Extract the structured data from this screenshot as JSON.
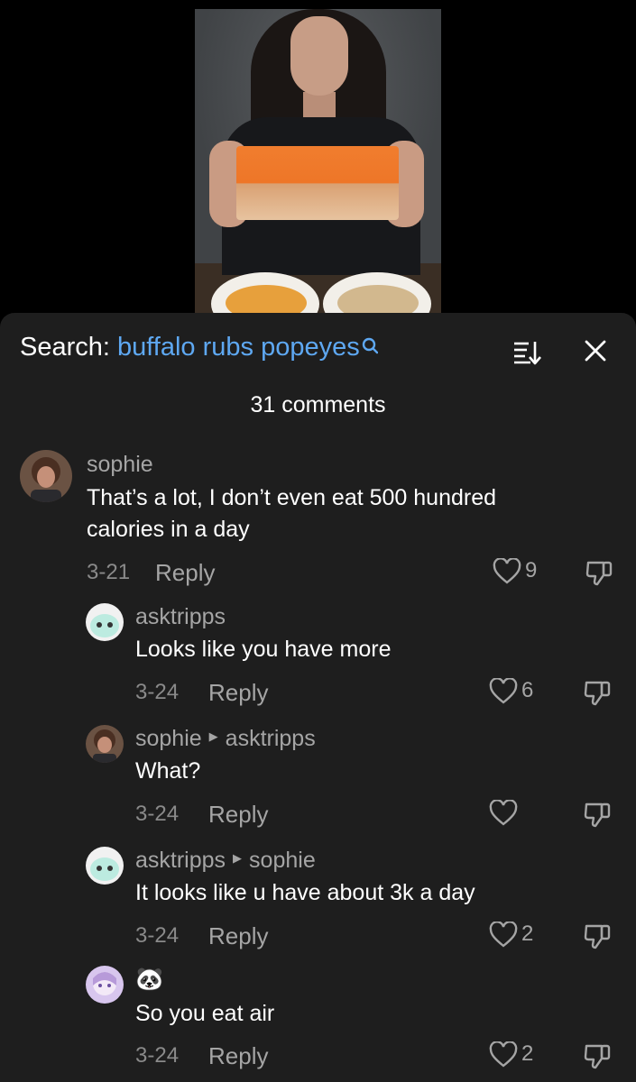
{
  "search": {
    "prefix": "Search:",
    "query": "buffalo rubs popeyes"
  },
  "comments_count": "31 comments",
  "reply_label": "Reply",
  "comments": [
    {
      "user": "sophie",
      "reply_to": "",
      "text": "That’s a lot, I don’t even eat 500 hundred calories in a day",
      "date": "3-21",
      "likes": "9"
    },
    {
      "user": "asktripps",
      "reply_to": "",
      "text": "Looks like you have more",
      "date": "3-24",
      "likes": "6"
    },
    {
      "user": "sophie",
      "reply_to": "asktripps",
      "text": "What?",
      "date": "3-24",
      "likes": ""
    },
    {
      "user": "asktripps",
      "reply_to": "sophie",
      "text": "It looks like u have about 3k a day",
      "date": "3-24",
      "likes": "2"
    },
    {
      "user": "🐼",
      "reply_to": "",
      "text": "So you eat air",
      "date": "3-24",
      "likes": "2"
    }
  ],
  "colors": {
    "sheet": "#1e1e1e",
    "query": "#5ea8f2",
    "muted": "#a5a5a5"
  },
  "icons": [
    "search-icon",
    "sort-icon",
    "close-icon",
    "heart-icon",
    "dislike-icon"
  ]
}
